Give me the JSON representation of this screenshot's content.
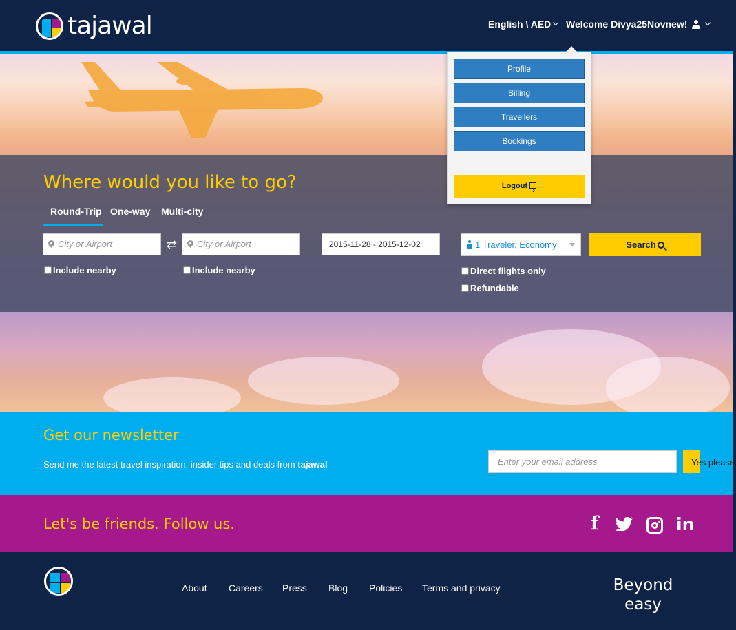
{
  "header": {
    "brand": "tajawal",
    "language_currency": "English \\ AED",
    "welcome": "Welcome Divya25Novnew!"
  },
  "user_menu": {
    "items": [
      "Profile",
      "Billing",
      "Travellers",
      "Bookings"
    ],
    "logout": "Logout"
  },
  "search": {
    "title": "Where would you like to go?",
    "tabs": [
      "Round-Trip",
      "One-way",
      "Multi-city"
    ],
    "active_tab": "Round-Trip",
    "origin_placeholder": "City or Airport",
    "destination_placeholder": "City or Airport",
    "dates": "2015-11-28 - 2015-12-02",
    "travelers": "1 Traveler, Economy",
    "search_label": "Search",
    "include_nearby": "Include nearby",
    "direct_flights": "Direct flights only",
    "refundable": "Refundable"
  },
  "newsletter": {
    "title": "Get our newsletter",
    "text": "Send me the latest travel inspiration, insider tips and deals from",
    "text_brand": "tajawal",
    "email_placeholder": "Enter your email address",
    "subscribe_label": "Yes please!"
  },
  "social": {
    "title": "Let's be friends. Follow us.",
    "icons": [
      "facebook-icon",
      "twitter-icon",
      "instagram-icon",
      "linkedin-icon"
    ]
  },
  "footer": {
    "links": [
      "About",
      "Careers",
      "Press",
      "Blog",
      "Policies",
      "Terms and privacy"
    ],
    "tagline_line1": "Beyond",
    "tagline_line2": "easy"
  },
  "colors": {
    "navy": "#0f2346",
    "accent_blue": "#00aeef",
    "yellow": "#ffcc00",
    "magenta": "#a5198d",
    "menu_blue": "#2f7ec1"
  }
}
